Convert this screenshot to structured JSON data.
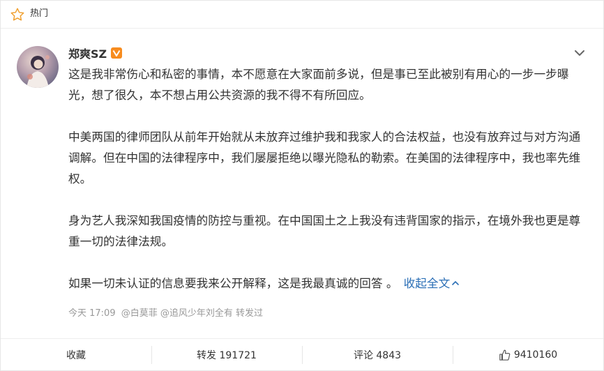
{
  "colors": {
    "accent_link": "#2b6fb6",
    "vip_badge": "#f78c1f",
    "muted": "#999999"
  },
  "header": {
    "icon": "star-outline-icon",
    "title": "热门"
  },
  "post": {
    "author": "郑爽SZ",
    "badge_icon": "v-verified-badge-icon",
    "paragraphs": [
      "这是我非常伤心和私密的事情，本不愿意在大家面前多说，但是事已至此被别有用心的一步一步曝光，想了很久，本不想占用公共资源的我不得不有所回应。",
      "中美两国的律师团队从前年开始就从未放弃过维护我和我家人的合法权益，也没有放弃过与对方沟通调解。但在中国的法律程序中，我们屡屡拒绝以曝光隐私的勒索。在美国的法律程序中，我也率先维权。",
      "身为艺人我深知我国疫情的防控与重视。在中国国土之上我没有违背国家的指示，在境外我也更是尊重一切的法律法规。"
    ],
    "last_paragraph": "如果一切未认证的信息要我来公开解释，这是我最真诚的回答 。",
    "collapse_label": "收起全文",
    "time": "今天 17:09",
    "source": "@白莫菲 @追风少年刘全有 转发过"
  },
  "actions": {
    "favorite": "收藏",
    "repost": "转发 191721",
    "comment": "评论 4843",
    "like": "9410160"
  }
}
